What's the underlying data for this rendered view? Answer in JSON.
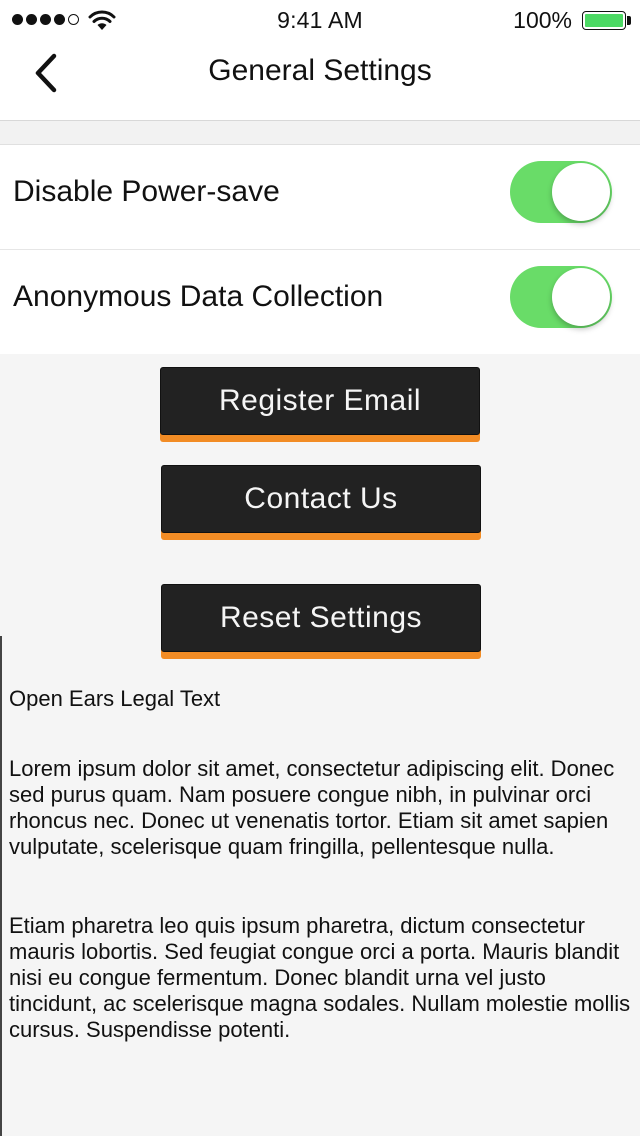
{
  "status_bar": {
    "time": "9:41 AM",
    "battery_percent": "100%",
    "signal_bars": 4,
    "signal_total": 5,
    "battery_color": "#4cd964"
  },
  "nav": {
    "title": "General Settings",
    "back_icon": "chevron-left-icon"
  },
  "settings": [
    {
      "label": "Disable Power-save",
      "enabled": true
    },
    {
      "label": "Anonymous Data Collection",
      "enabled": true
    }
  ],
  "toggle_on_color": "#69dc68",
  "accent_color": "#f28c25",
  "buttons": {
    "register": "Register Email",
    "contact": "Contact Us",
    "reset": "Reset Settings"
  },
  "legal": {
    "title": "Open Ears Legal Text",
    "paragraph1": "Lorem ipsum dolor sit amet, consectetur adipiscing elit. Donec sed purus quam. Nam posuere congue nibh, in pulvinar orci rhoncus nec. Donec ut venenatis tortor. Etiam sit amet sapien vulputate, scelerisque quam fringilla, pellentesque nulla.",
    "paragraph2": "Etiam pharetra leo quis ipsum pharetra, dictum consectetur mauris lobortis. Sed feugiat congue orci a porta. Mauris blandit nisi eu congue fermentum. Donec blandit urna vel justo tincidunt, ac scelerisque magna sodales. Nullam molestie mollis cursus. Suspendisse potenti."
  }
}
